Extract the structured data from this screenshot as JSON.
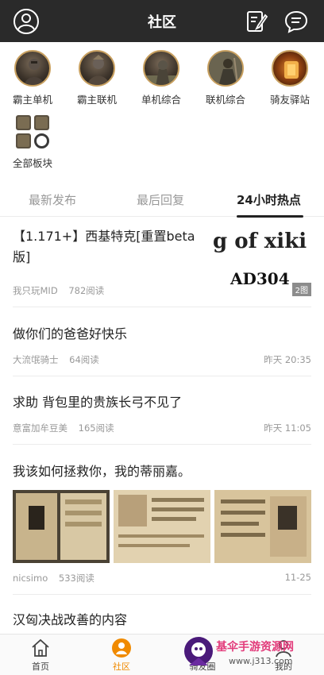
{
  "header": {
    "title": "社区"
  },
  "boards": [
    {
      "label": "霸主单机"
    },
    {
      "label": "霸主联机"
    },
    {
      "label": "单机综合"
    },
    {
      "label": "联机综合"
    },
    {
      "label": "骑友驿站"
    },
    {
      "label": "全部板块"
    }
  ],
  "tabs": [
    {
      "label": "最新发布"
    },
    {
      "label": "最后回复"
    },
    {
      "label": "24小时热点",
      "active": true
    }
  ],
  "posts": [
    {
      "title": "【1.171+】西基特克[重置beta版]",
      "author": "我只玩MID",
      "reads": "782阅读",
      "time": "",
      "thumb_text_1": "g of xiki",
      "thumb_text_2": "AD304",
      "image_count": "2图"
    },
    {
      "title": "做你们的爸爸好快乐",
      "author": "大流氓骑士",
      "reads": "64阅读",
      "time": "昨天 20:35"
    },
    {
      "title": "求助 背包里的贵族长弓不见了",
      "author": "意富加牟豆美",
      "reads": "165阅读",
      "time": "昨天 11:05"
    },
    {
      "title": "我该如何拯救你，我的蒂丽嘉。",
      "author": "nicsimo",
      "reads": "533阅读",
      "time": "11-25"
    },
    {
      "title": "汉匈决战改善的内容"
    }
  ],
  "bottom_nav": [
    {
      "label": "首页",
      "icon": "home-icon"
    },
    {
      "label": "社区",
      "icon": "community-icon",
      "active": true
    },
    {
      "label": "骑友圈",
      "icon": "friends-icon"
    },
    {
      "label": "我的",
      "icon": "profile-icon"
    }
  ],
  "watermark": {
    "text": "基伞手游资源网",
    "url": "www.j313.com"
  },
  "colors": {
    "header_bg": "#2a2a2a",
    "accent": "#f08a00"
  }
}
